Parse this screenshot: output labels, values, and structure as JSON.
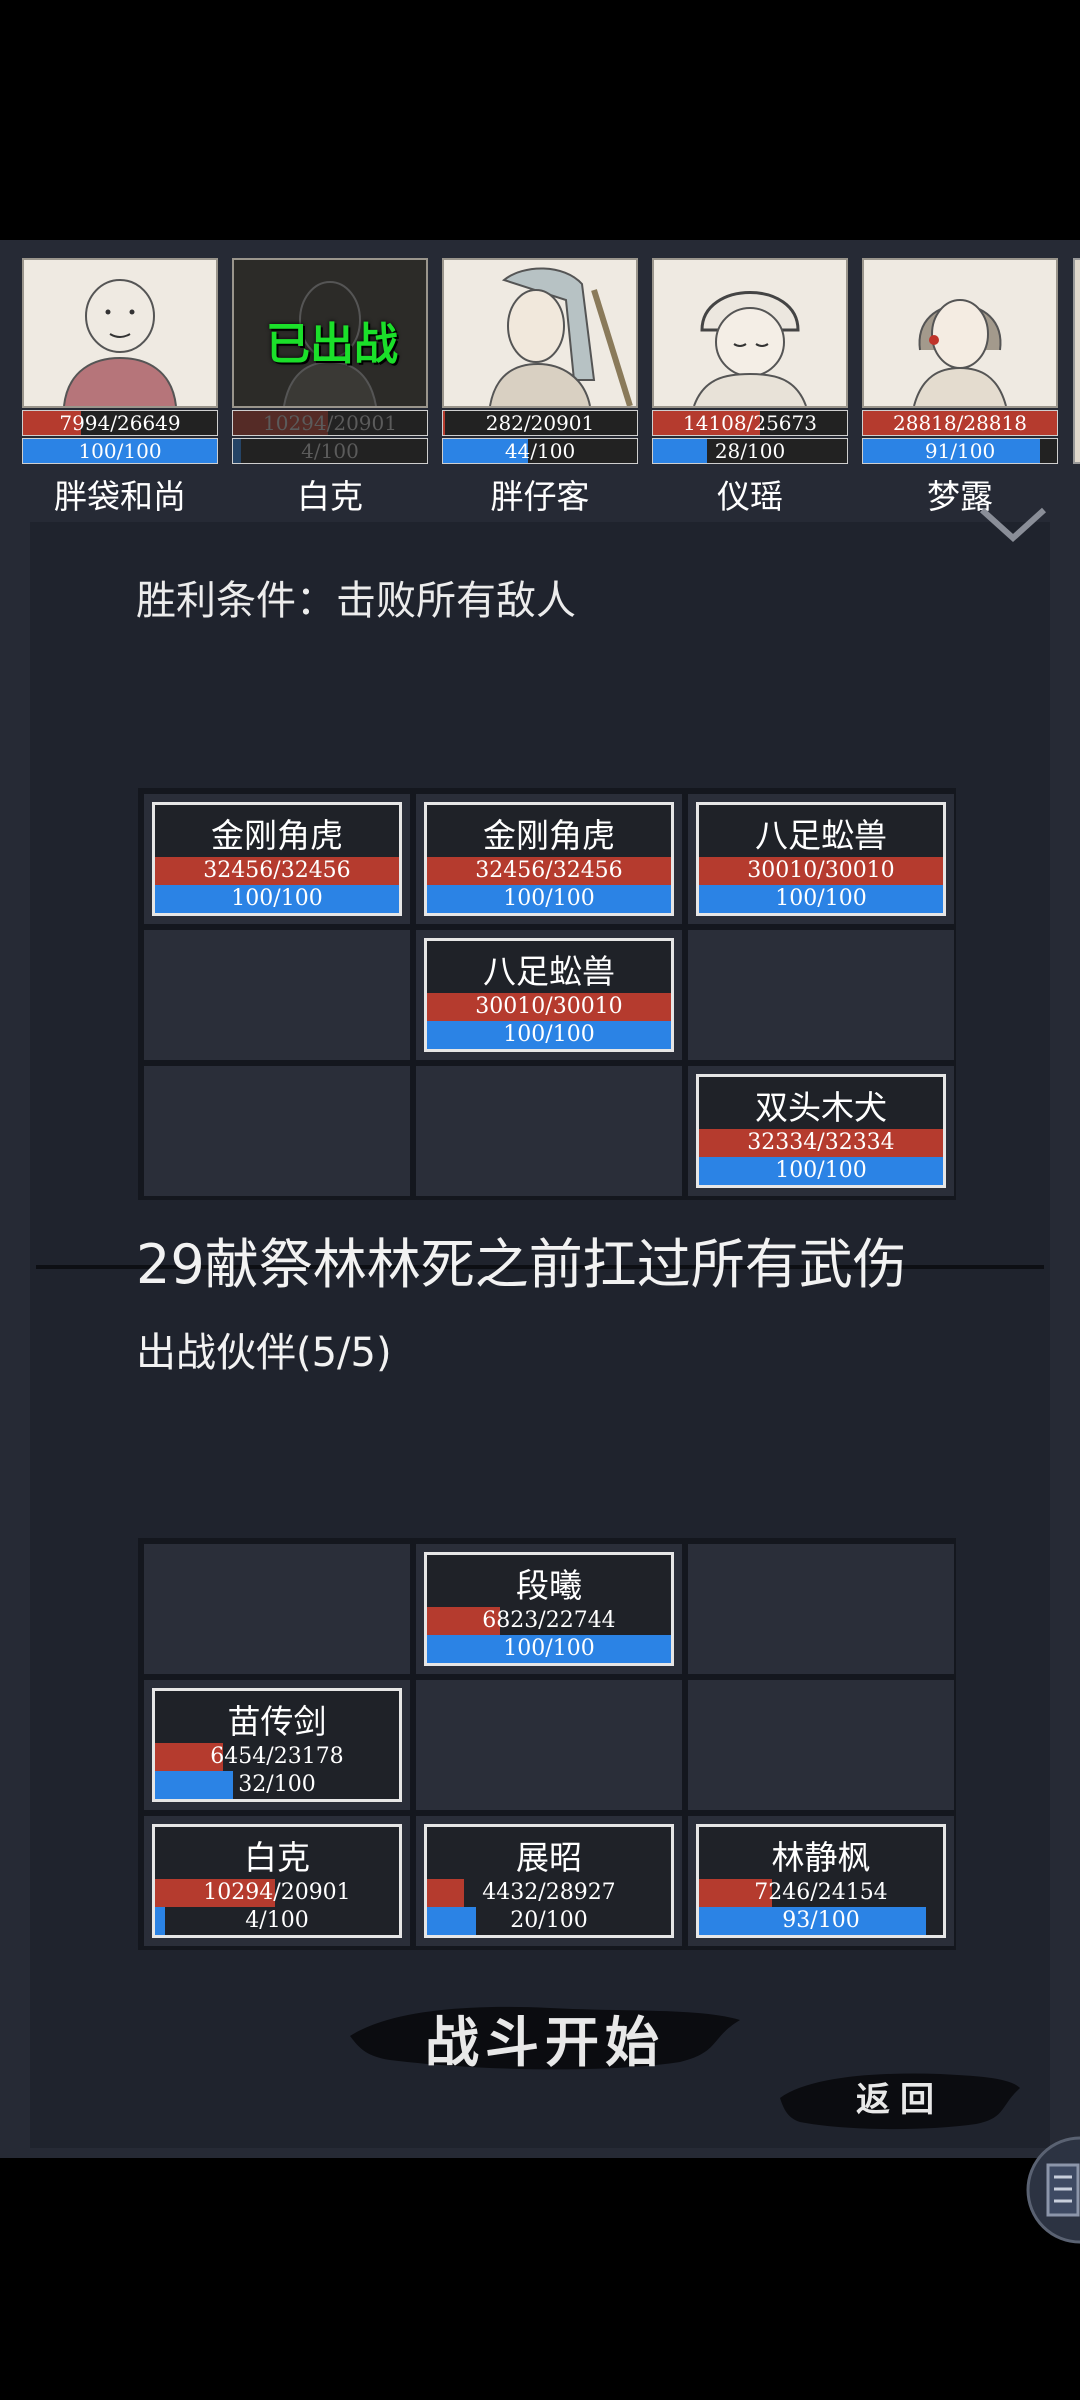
{
  "roster": [
    {
      "name": "胖袋和尚",
      "hp": "7994/26649",
      "hp_ratio": 0.3,
      "mp": "100/100",
      "mp_ratio": 1.0,
      "deployed": false
    },
    {
      "name": "白克",
      "hp": "10294/20901",
      "hp_ratio": 0.49,
      "mp": "4/100",
      "mp_ratio": 0.04,
      "deployed": true,
      "deployed_label": "已出战"
    },
    {
      "name": "胖仔客",
      "hp": "282/20901",
      "hp_ratio": 0.01,
      "mp": "44/100",
      "mp_ratio": 0.44,
      "deployed": false
    },
    {
      "name": "仪瑶",
      "hp": "14108/25673",
      "hp_ratio": 0.55,
      "mp": "28/100",
      "mp_ratio": 0.28,
      "deployed": false
    },
    {
      "name": "梦露",
      "hp": "28818/28818",
      "hp_ratio": 1.0,
      "mp": "91/100",
      "mp_ratio": 0.91,
      "deployed": false
    }
  ],
  "victory_condition": "胜利条件：击败所有敌人",
  "enemies": [
    {
      "name": "金刚角虎",
      "hp": "32456/32456",
      "hp_ratio": 1.0,
      "mp": "100/100",
      "mp_ratio": 1.0,
      "row": 0,
      "col": 0
    },
    {
      "name": "金刚角虎",
      "hp": "32456/32456",
      "hp_ratio": 1.0,
      "mp": "100/100",
      "mp_ratio": 1.0,
      "row": 0,
      "col": 1
    },
    {
      "name": "八足蚣兽",
      "hp": "30010/30010",
      "hp_ratio": 1.0,
      "mp": "100/100",
      "mp_ratio": 1.0,
      "row": 0,
      "col": 2
    },
    {
      "name": "八足蚣兽",
      "hp": "30010/30010",
      "hp_ratio": 1.0,
      "mp": "100/100",
      "mp_ratio": 1.0,
      "row": 1,
      "col": 1
    },
    {
      "name": "双头木犬",
      "hp": "32334/32334",
      "hp_ratio": 1.0,
      "mp": "100/100",
      "mp_ratio": 1.0,
      "row": 2,
      "col": 2
    }
  ],
  "mission_title": "29献祭林林死之前扛过所有武伤",
  "team_label": "出战伙伴(5/5)",
  "allies": [
    {
      "name": "段曦",
      "hp": "6823/22744",
      "hp_ratio": 0.3,
      "mp": "100/100",
      "mp_ratio": 1.0,
      "row": 0,
      "col": 1
    },
    {
      "name": "苗传剑",
      "hp": "6454/23178",
      "hp_ratio": 0.28,
      "mp": "32/100",
      "mp_ratio": 0.32,
      "row": 1,
      "col": 0
    },
    {
      "name": "白克",
      "hp": "10294/20901",
      "hp_ratio": 0.49,
      "mp": "4/100",
      "mp_ratio": 0.04,
      "row": 2,
      "col": 0
    },
    {
      "name": "展昭",
      "hp": "4432/28927",
      "hp_ratio": 0.15,
      "mp": "20/100",
      "mp_ratio": 0.2,
      "row": 2,
      "col": 1
    },
    {
      "name": "林静枫",
      "hp": "7246/24154",
      "hp_ratio": 0.3,
      "mp": "93/100",
      "mp_ratio": 0.93,
      "row": 2,
      "col": 2
    }
  ],
  "buttons": {
    "start": "战斗开始",
    "back": "返回"
  },
  "colors": {
    "hp": "#b53b2e",
    "mp": "#2b83e5",
    "deployed": "#1be02a",
    "panel": "#1f232d"
  }
}
